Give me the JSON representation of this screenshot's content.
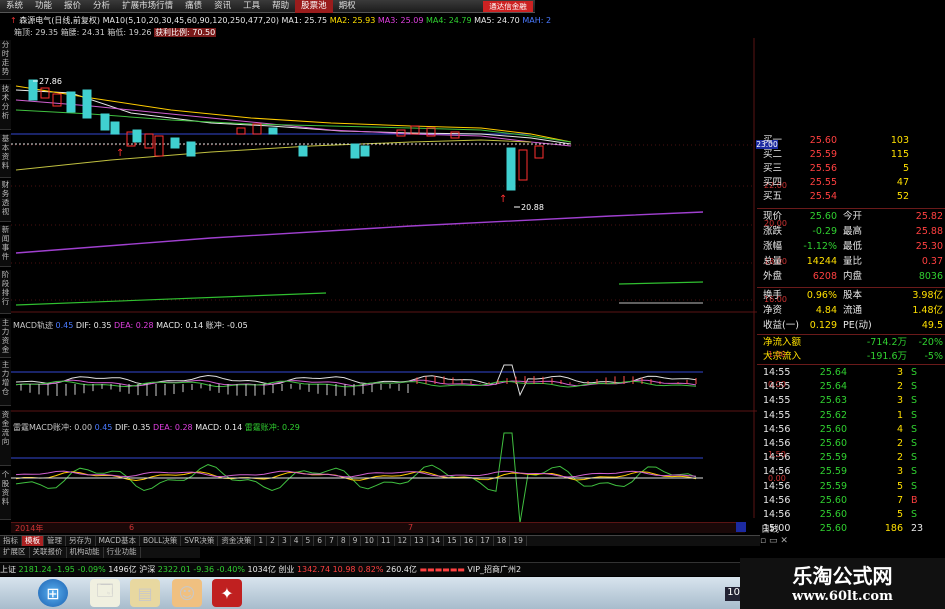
{
  "menu": [
    "系统",
    "功能",
    "报价",
    "分析",
    "扩展市场行情",
    "痛债",
    "资讯",
    "工具",
    "帮助",
    "股票池",
    "期权"
  ],
  "menu_highlight": "通达信金融",
  "ma_header": {
    "name": "森源电气(日线,前复权)",
    "ma10": "MA10(5,10,20,30,45,60,90,120,250,477,20)",
    "ma1": "MA1: 25.75",
    "ma2": "MA2: 25.93",
    "ma3": "MA3: 25.09",
    "ma4": "MA4: 24.79",
    "ma5": "MA5: 24.70",
    "mah": "MAH: 2"
  },
  "sub_header": {
    "a": "箱顶: 29.35",
    "b": "箱腰: 24.31",
    "c": "箱低: 19.26",
    "d": "获利比例: 70.50"
  },
  "left_tabs": [
    "分时走势",
    "技术分析",
    "基本资料",
    "财务透视",
    "新闻事件",
    "阶段排行",
    "主力资金",
    "主力增仓",
    "资金流向",
    "个股资料"
  ],
  "price_annot": {
    "high": "27.86",
    "low": "20.88"
  },
  "axis": {
    "p1": "23.00",
    "p2": "22.00",
    "p3": "20.00",
    "p4": "18.00",
    "p5": "16.00",
    "m1": "1.00",
    "m2": "0.00",
    "m3": "1.50",
    "m4": "0.00"
  },
  "macd1": {
    "title": "MACD轨迹",
    "v0": "0.45",
    "dif": "DIF: 0.35",
    "dea": "DEA: 0.28",
    "macd": "MACD: 0.14",
    "zc": "账冲: -0.05"
  },
  "macd2": {
    "title": "雷霆MACD账冲: 0.00",
    "v0": "0.45",
    "dif": "DIF: 0.35",
    "dea": "DEA: 0.28",
    "macd": "MACD: 0.14",
    "zc": "雷霆账冲: 0.29"
  },
  "xaxis": {
    "y": "2014年",
    "m1": "6",
    "m2": "7",
    "right": "日线"
  },
  "quote": {
    "bids": [
      {
        "l": "买一",
        "p": "25.60",
        "v": "103"
      },
      {
        "l": "买二",
        "p": "25.59",
        "v": "115"
      },
      {
        "l": "买三",
        "p": "25.56",
        "v": "5"
      },
      {
        "l": "买四",
        "p": "25.55",
        "v": "47"
      },
      {
        "l": "买五",
        "p": "25.54",
        "v": "52"
      }
    ],
    "stats": [
      {
        "a": "现价",
        "b": "25.60",
        "c": "今开",
        "d": "25.82"
      },
      {
        "a": "涨跌",
        "b": "-0.29",
        "c": "最高",
        "d": "25.88"
      },
      {
        "a": "涨幅",
        "b": "-1.12%",
        "c": "最低",
        "d": "25.30"
      },
      {
        "a": "总量",
        "b": "14244",
        "c": "量比",
        "d": "0.37"
      },
      {
        "a": "外盘",
        "b": "6208",
        "c": "内盘",
        "d": "8036"
      }
    ],
    "fund": [
      {
        "a": "换手",
        "b": "0.96%",
        "c": "股本",
        "d": "3.98亿"
      },
      {
        "a": "净资",
        "b": "4.84",
        "c": "流通",
        "d": "1.48亿"
      },
      {
        "a": "收益(一)",
        "b": "0.129",
        "c": "PE(动)",
        "d": "49.5"
      }
    ],
    "flow": [
      {
        "a": "净流入额",
        "b": "-714.2万",
        "c": "-20%"
      },
      {
        "a": "大宗流入",
        "b": "-191.6万",
        "c": "-5%"
      }
    ],
    "ticks": [
      {
        "t": "14:55",
        "p": "25.64",
        "v": "3",
        "s": "S"
      },
      {
        "t": "14:55",
        "p": "25.64",
        "v": "2",
        "s": "S"
      },
      {
        "t": "14:55",
        "p": "25.63",
        "v": "3",
        "s": "S"
      },
      {
        "t": "14:55",
        "p": "25.62",
        "v": "1",
        "s": "S"
      },
      {
        "t": "14:56",
        "p": "25.60",
        "v": "4",
        "s": "S"
      },
      {
        "t": "14:56",
        "p": "25.60",
        "v": "2",
        "s": "S"
      },
      {
        "t": "14:56",
        "p": "25.59",
        "v": "2",
        "s": "S"
      },
      {
        "t": "14:56",
        "p": "25.59",
        "v": "3",
        "s": "S"
      },
      {
        "t": "14:56",
        "p": "25.59",
        "v": "5",
        "s": "S"
      },
      {
        "t": "14:56",
        "p": "25.60",
        "v": "7",
        "s": "B"
      },
      {
        "t": "14:56",
        "p": "25.60",
        "v": "5",
        "s": "S"
      },
      {
        "t": "15:00",
        "p": "25.60",
        "v": "186",
        "s": "23"
      }
    ]
  },
  "bottom_tabs": [
    "指标",
    "模板",
    "管理",
    "另存为",
    "MACD基本",
    "BOLL决策",
    "SVR决策",
    "资金决策",
    "1",
    "2",
    "3",
    "4",
    "5",
    "6",
    "7",
    "8",
    "9",
    "10",
    "11",
    "12",
    "13",
    "14",
    "15",
    "16",
    "17",
    "18",
    "19"
  ],
  "bottom_tabs2": [
    "扩展区",
    "关联报价",
    "机构动能",
    "行业功能"
  ],
  "status": {
    "sh": "上证",
    "sh_v": "2181.24",
    "sh_c": "-1.95",
    "sh_p": "-0.09%",
    "sh_a": "1496亿",
    "hs": "沪深",
    "hs_v": "2322.01",
    "hs_c": "-9.36",
    "hs_p": "-0.40%",
    "hs_a": "1034亿",
    "cy": "创业",
    "cy_v": "1342.74",
    "cy_c": "10.98",
    "cy_p": "0.82%",
    "cy_a": "260.4亿",
    "vip": "VIP_招商广州2"
  },
  "watermark": {
    "title": "乐淘公式网",
    "url": "www.60lt.com"
  },
  "tray": {
    "time": "1009"
  }
}
